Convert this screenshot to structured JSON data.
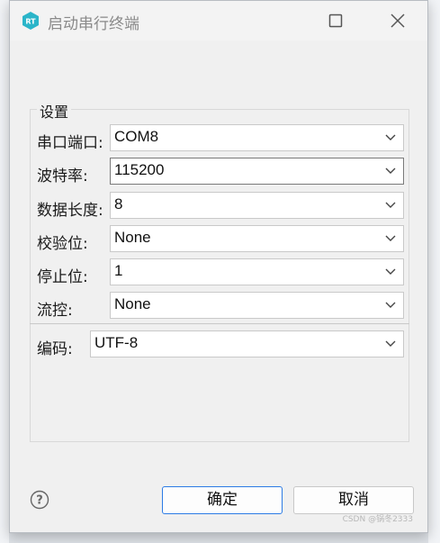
{
  "window": {
    "title": "启动串行终端",
    "logo_text": "RT"
  },
  "group": {
    "label": "设置"
  },
  "fields": [
    {
      "label": "串口端口:",
      "value": "COM8"
    },
    {
      "label": "波特率:",
      "value": "115200"
    },
    {
      "label": "数据长度:",
      "value": "8"
    },
    {
      "label": "校验位:",
      "value": "None"
    },
    {
      "label": "停止位:",
      "value": "1"
    },
    {
      "label": "流控:",
      "value": "None"
    }
  ],
  "encoding": {
    "label": "编码:",
    "value": "UTF-8"
  },
  "buttons": {
    "ok": "确定",
    "cancel": "取消",
    "help": "?"
  },
  "watermark": "CSDN @锅冬2333",
  "colors": {
    "accent": "#2c7be5",
    "logo": "#2bb5c9"
  }
}
